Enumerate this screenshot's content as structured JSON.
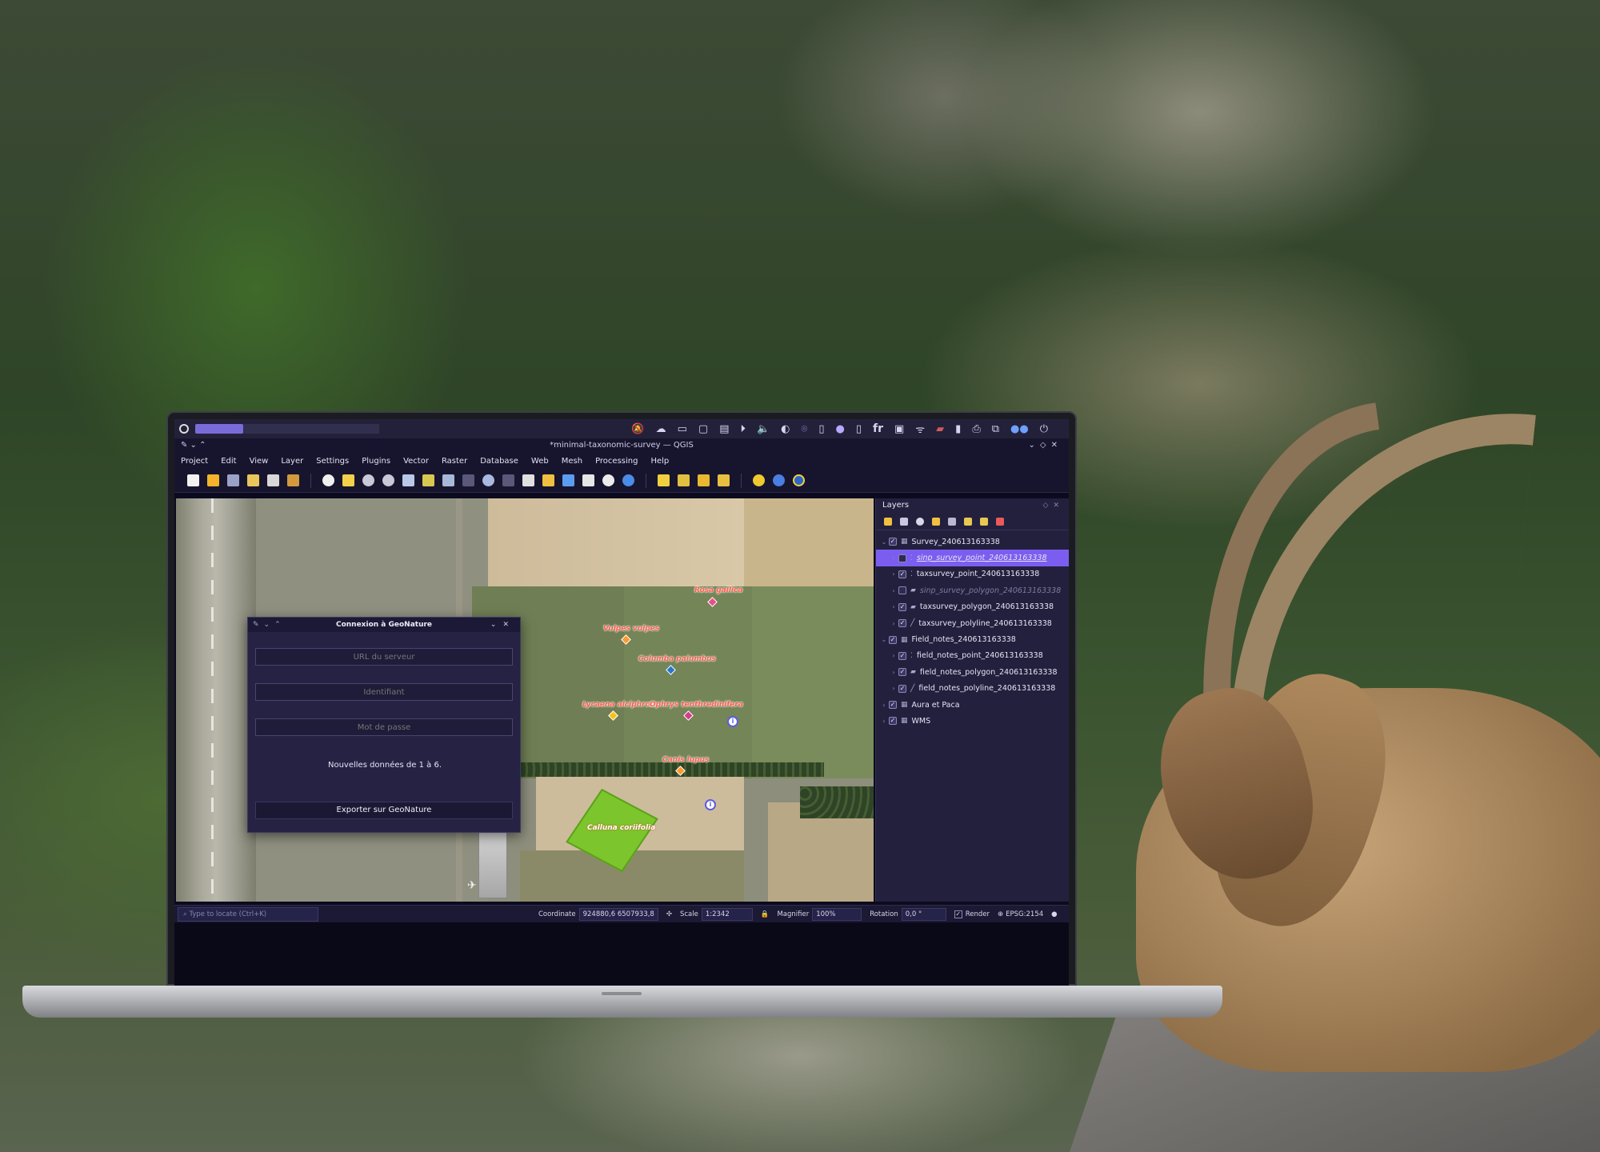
{
  "topbar": {
    "tray_icons": [
      "bell-off-icon",
      "cloud-icon",
      "monitor-icon",
      "window-icon",
      "printer-icon",
      "play-icon",
      "volume-icon",
      "brightness-icon",
      "location-icon",
      "phone-icon",
      "moon-icon",
      "clock-icon"
    ],
    "keyboard_layout": "fr"
  },
  "window": {
    "title": "*minimal-taxonomic-survey — QGIS"
  },
  "menu": [
    "Project",
    "Edit",
    "View",
    "Layer",
    "Settings",
    "Plugins",
    "Vector",
    "Raster",
    "Database",
    "Web",
    "Mesh",
    "Processing",
    "Help"
  ],
  "dialog": {
    "title": "Connexion à GeoNature",
    "server_placeholder": "URL du serveur",
    "login_placeholder": "Identifiant",
    "password_placeholder": "Mot de passe",
    "message": "Nouvelles données de 1 à 6.",
    "export_label": "Exporter sur GeoNature"
  },
  "map": {
    "species": [
      {
        "label": "Rosa gallica",
        "color": "#e8508c"
      },
      {
        "label": "Vulpes vulpes",
        "color": "#ff9a2e"
      },
      {
        "label": "Columba palumbus",
        "color": "#2c78c8"
      },
      {
        "label": "Lycaena alciphron",
        "color": "#f5c21c"
      },
      {
        "label": "Ophrys tenthredinifera",
        "color": "#d43c8c"
      },
      {
        "label": "Canis lupus",
        "color": "#ff9a2e"
      }
    ],
    "polygon_label": "Calluna coriifolia",
    "note_icon": "i"
  },
  "layers_panel": {
    "title": "Layers",
    "rows": [
      {
        "label": "Survey_240613163338",
        "level": 0,
        "checked": true,
        "expanded": true,
        "icon": "group-icon"
      },
      {
        "label": "sinp_survey_point_240613163338",
        "level": 1,
        "checked": false,
        "selected": true,
        "icon": "point-layer-icon"
      },
      {
        "label": "taxsurvey_point_240613163338",
        "level": 1,
        "checked": true,
        "icon": "point-layer-icon"
      },
      {
        "label": "sinp_survey_polygon_240613163338",
        "level": 1,
        "checked": false,
        "dim": true,
        "icon": "polygon-layer-icon"
      },
      {
        "label": "taxsurvey_polygon_240613163338",
        "level": 1,
        "checked": true,
        "icon": "polygon-layer-icon"
      },
      {
        "label": "taxsurvey_polyline_240613163338",
        "level": 1,
        "checked": true,
        "icon": "line-layer-icon"
      },
      {
        "label": "Field_notes_240613163338",
        "level": 0,
        "checked": true,
        "expanded": true,
        "icon": "group-icon"
      },
      {
        "label": "field_notes_point_240613163338",
        "level": 1,
        "checked": true,
        "icon": "point-layer-icon"
      },
      {
        "label": "field_notes_polygon_240613163338",
        "level": 1,
        "checked": true,
        "icon": "polygon-layer-icon"
      },
      {
        "label": "field_notes_polyline_240613163338",
        "level": 1,
        "checked": true,
        "icon": "line-layer-icon"
      },
      {
        "label": "Aura et Paca",
        "level": 0,
        "checked": true,
        "icon": "group-icon"
      },
      {
        "label": "WMS",
        "level": 0,
        "checked": true,
        "icon": "group-icon"
      }
    ]
  },
  "status": {
    "locate_placeholder": "Type to locate (Ctrl+K)",
    "coordinate_label": "Coordinate",
    "coordinate_value": "924880,6 6507933,8",
    "scale_label": "Scale",
    "scale_value": "1:2342",
    "magnifier_label": "Magnifier",
    "magnifier_value": "100%",
    "rotation_label": "Rotation",
    "rotation_value": "0,0 °",
    "render_label": "Render",
    "crs_label": "EPSG:2154"
  },
  "colors": {
    "accent": "#7b5ef0",
    "panel_bg": "#23203e",
    "dialog_bg": "#262244"
  }
}
